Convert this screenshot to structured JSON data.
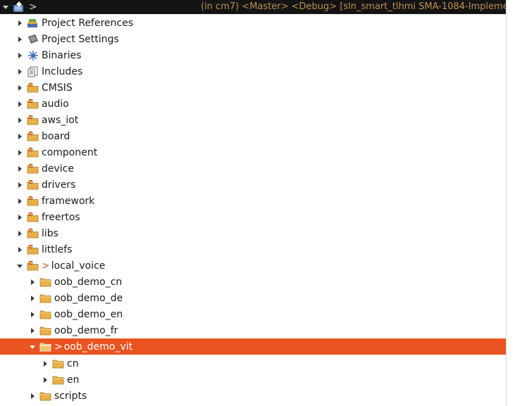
{
  "header": {
    "project_prefix": ">",
    "decoration": "(in cm7) <Master> <Debug> [sln_smart_tlhmi SMA-1084-Impleme"
  },
  "items": [
    {
      "label": "Project References",
      "icon": "references-icon"
    },
    {
      "label": "Project Settings",
      "icon": "settings-icon"
    },
    {
      "label": "Binaries",
      "icon": "binaries-icon"
    },
    {
      "label": "Includes",
      "icon": "includes-icon"
    },
    {
      "label": "CMSIS",
      "icon": "source-folder-icon"
    },
    {
      "label": "audio",
      "icon": "source-folder-icon"
    },
    {
      "label": "aws_iot",
      "icon": "source-folder-icon"
    },
    {
      "label": "board",
      "icon": "source-folder-icon"
    },
    {
      "label": "component",
      "icon": "source-folder-icon"
    },
    {
      "label": "device",
      "icon": "source-folder-icon"
    },
    {
      "label": "drivers",
      "icon": "source-folder-icon"
    },
    {
      "label": "framework",
      "icon": "source-folder-icon"
    },
    {
      "label": "freertos",
      "icon": "source-folder-icon"
    },
    {
      "label": "libs",
      "icon": "source-folder-icon"
    },
    {
      "label": "littlefs",
      "icon": "source-folder-icon"
    },
    {
      "label": "local_voice",
      "icon": "source-folder-icon",
      "prefix": ">"
    },
    {
      "label": "oob_demo_cn",
      "icon": "folder-icon"
    },
    {
      "label": "oob_demo_de",
      "icon": "folder-icon"
    },
    {
      "label": "oob_demo_en",
      "icon": "folder-icon"
    },
    {
      "label": "oob_demo_fr",
      "icon": "folder-icon"
    },
    {
      "label": "oob_demo_vit",
      "icon": "folder-icon",
      "prefix": ">"
    },
    {
      "label": "cn",
      "icon": "folder-icon"
    },
    {
      "label": "en",
      "icon": "folder-icon"
    },
    {
      "label": "scripts",
      "icon": "folder-icon"
    }
  ],
  "colors": {
    "selection": "#e95420",
    "header_bg": "#141414",
    "decoration_text": "#bf8f54",
    "folder": "#e8b04a"
  }
}
